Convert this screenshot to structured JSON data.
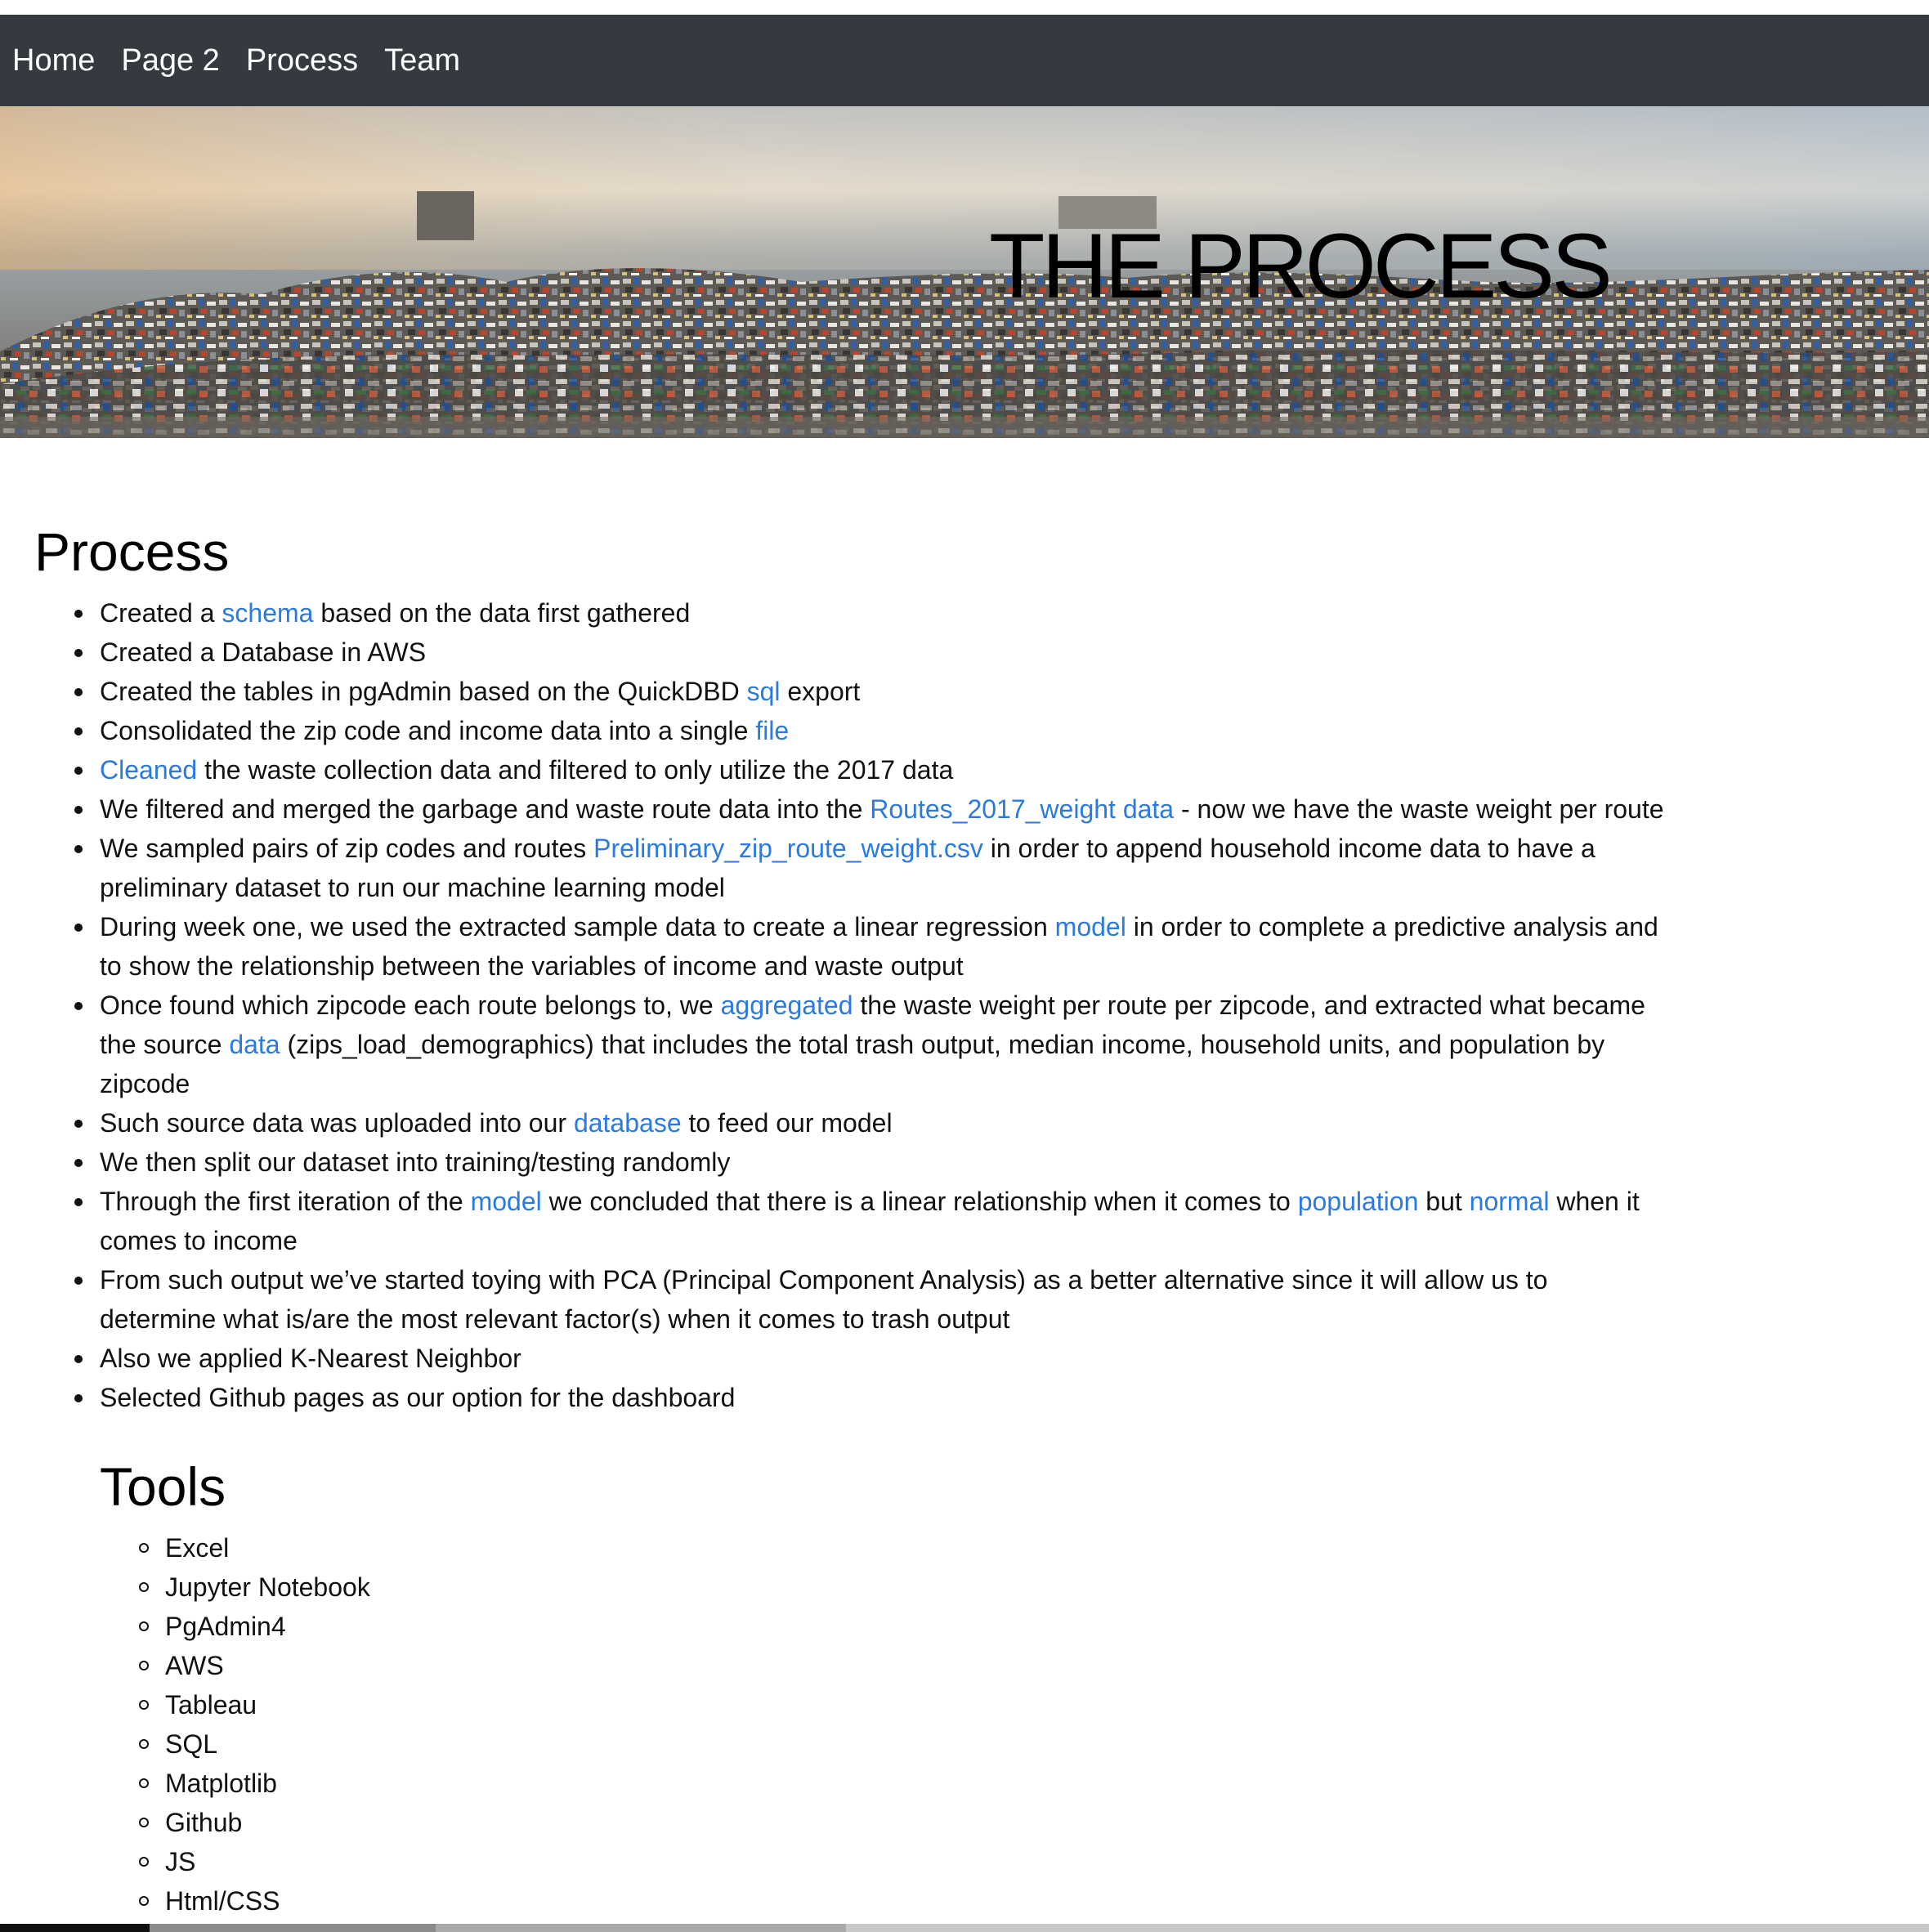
{
  "nav": {
    "items": [
      {
        "label": "Home"
      },
      {
        "label": "Page 2"
      },
      {
        "label": "Process"
      },
      {
        "label": "Team"
      }
    ]
  },
  "hero": {
    "title": "THE PROCESS"
  },
  "process": {
    "heading": "Process",
    "items": [
      {
        "parts": [
          {
            "t": "Created a "
          },
          {
            "link": "schema"
          },
          {
            "t": " based on the data first gathered"
          }
        ]
      },
      {
        "parts": [
          {
            "t": "Created a Database in AWS"
          }
        ]
      },
      {
        "parts": [
          {
            "t": "Created the tables in pgAdmin based on the QuickDBD "
          },
          {
            "link": "sql"
          },
          {
            "t": " export"
          }
        ]
      },
      {
        "parts": [
          {
            "t": "Consolidated the zip code and income data into a single "
          },
          {
            "link": "file"
          }
        ]
      },
      {
        "parts": [
          {
            "link": "Cleaned"
          },
          {
            "t": " the waste collection data and filtered to only utilize the 2017 data"
          }
        ]
      },
      {
        "parts": [
          {
            "t": "We filtered and merged the garbage and waste route data into the "
          },
          {
            "link": "Routes_2017_weight data"
          },
          {
            "t": " - now we have the waste weight per route"
          }
        ]
      },
      {
        "parts": [
          {
            "t": "We sampled pairs of zip codes and routes "
          },
          {
            "link": "Preliminary_zip_route_weight.csv"
          },
          {
            "t": " in order to append household income data to have a preliminary dataset to run our machine learning model"
          }
        ]
      },
      {
        "parts": [
          {
            "t": "During week one, we used the extracted sample data to create a linear regression "
          },
          {
            "link": "model"
          },
          {
            "t": " in order to complete a predictive analysis and to show the relationship between the variables of income and waste output"
          }
        ]
      },
      {
        "parts": [
          {
            "t": "Once found which zipcode each route belongs to, we "
          },
          {
            "link": "aggregated"
          },
          {
            "t": " the waste weight per route per zipcode, and extracted what became the source "
          },
          {
            "link": "data"
          },
          {
            "t": " (zips_load_demographics) that includes the total trash output, median income, household units, and population by zipcode"
          }
        ]
      },
      {
        "parts": [
          {
            "t": "Such source data was uploaded into our "
          },
          {
            "link": "database"
          },
          {
            "t": " to feed our model"
          }
        ]
      },
      {
        "parts": [
          {
            "t": "We then split our dataset into training/testing randomly"
          }
        ]
      },
      {
        "parts": [
          {
            "t": "Through the first iteration of the "
          },
          {
            "link": "model"
          },
          {
            "t": " we concluded that there is a linear relationship when it comes to "
          },
          {
            "link": "population"
          },
          {
            "t": " but "
          },
          {
            "link": "normal"
          },
          {
            "t": " when it comes to income"
          }
        ]
      },
      {
        "parts": [
          {
            "t": "From such output we’ve started toying with PCA (Principal Component Analysis) as a better alternative since it will allow us to determine what is/are the most relevant factor(s) when it comes to trash output"
          }
        ]
      },
      {
        "parts": [
          {
            "t": "Also we applied K-Nearest Neighbor"
          }
        ]
      },
      {
        "parts": [
          {
            "t": "Selected Github pages as our option for the dashboard"
          }
        ]
      }
    ]
  },
  "tools": {
    "heading": "Tools",
    "items": [
      "Excel",
      "Jupyter Notebook",
      "PgAdmin4",
      "AWS",
      "Tableau",
      "SQL",
      "Matplotlib",
      "Github",
      "JS",
      "Html/CSS"
    ]
  }
}
